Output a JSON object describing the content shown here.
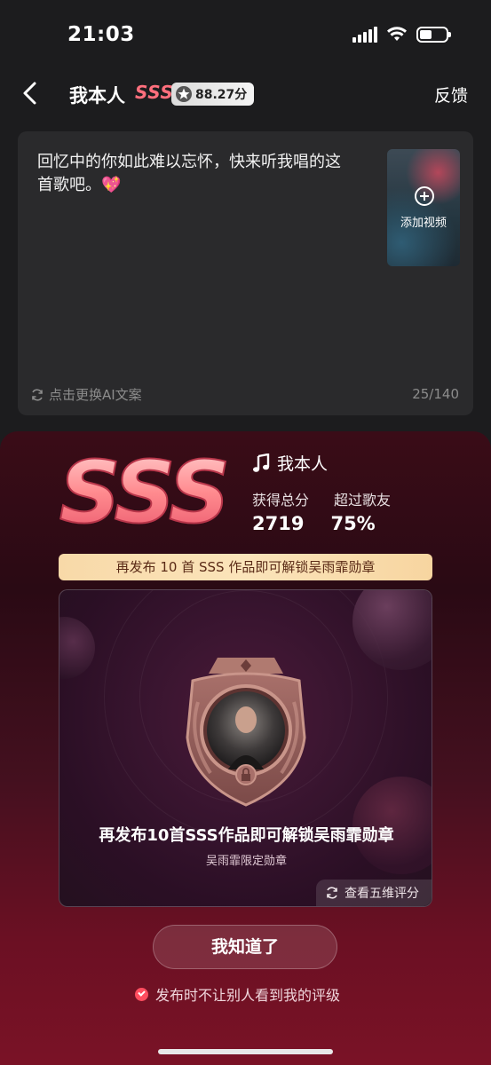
{
  "status_bar": {
    "time": "21:03",
    "battery_level": 0.45
  },
  "nav": {
    "title": "我本人",
    "grade": "SSS",
    "score": "88.27分",
    "feedback_label": "反馈"
  },
  "caption": {
    "text": "回忆中的你如此难以忘怀，快来听我唱的这首歌吧。💖",
    "add_video_label": "添加视频",
    "refresh_ai_label": "点击更换AI文案",
    "char_count": "25/140"
  },
  "result": {
    "grade": "SSS",
    "song_name": "我本人",
    "total_score_label": "获得总分",
    "total_score": "2719",
    "beat_label": "超过歌友",
    "beat_value": "75%",
    "unlock_banner": "再发布 10 首 SSS 作品即可解锁吴雨霏勋章"
  },
  "badge": {
    "title": "再发布10首SSS作品即可解锁吴雨霏勋章",
    "subtitle": "吴雨霏限定勋章",
    "five_dim_label": "查看五维评分"
  },
  "actions": {
    "ok_label": "我知道了",
    "hide_grade_label": "发布时不让别人看到我的评级",
    "hide_grade_checked": true
  },
  "colors": {
    "accent_pink": "#ff6f7d",
    "check_red": "#ff4d5f",
    "banner_gold": "#fbe4ba"
  }
}
